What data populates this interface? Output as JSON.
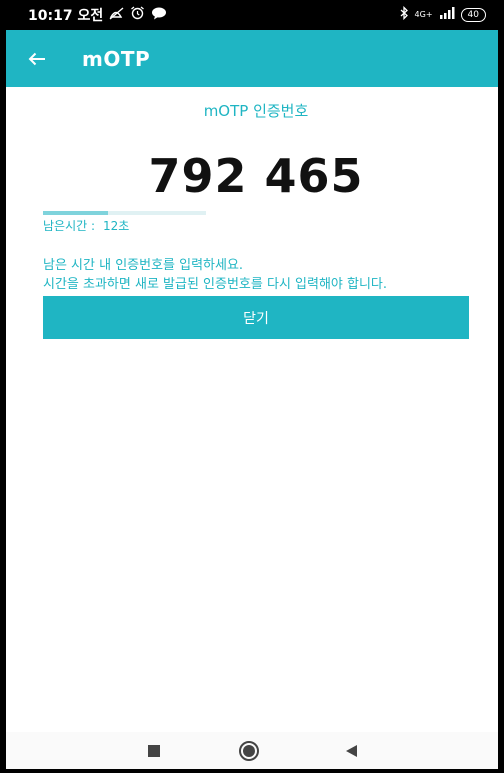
{
  "status_bar": {
    "time": "10:17 오전",
    "network": "4G+",
    "battery": "40"
  },
  "app_bar": {
    "title": "mOTP"
  },
  "otp": {
    "label": "mOTP 인증번호",
    "code": "792 465",
    "remaining_label": "남은시간 :",
    "remaining_value": "12초",
    "time_fraction": 0.4
  },
  "message": {
    "line1": "남은 시간 내 인증번호를 입력하세요.",
    "line2": "시간을 초과하면 새로 발급된 인증번호를 다시 입력해야 합니다."
  },
  "actions": {
    "close_label": "닫기"
  },
  "colors": {
    "accent": "#1fb5c3",
    "progress": "#7fd3dc"
  },
  "icons": {
    "back": "arrow-left-icon",
    "recent": "square-icon",
    "home": "circle-icon",
    "nav_back": "triangle-left-icon"
  }
}
